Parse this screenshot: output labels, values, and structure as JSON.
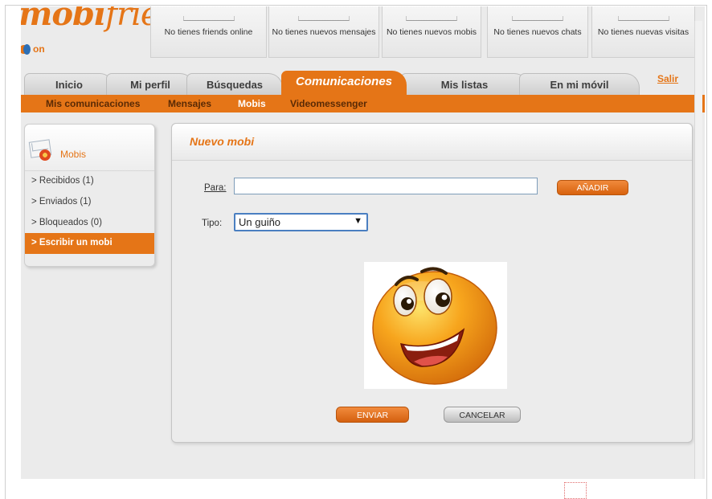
{
  "header": {
    "logo_bold": "mobi",
    "logo_thin": "friends",
    "status": "on",
    "notifications": [
      "No tienes friends online",
      "No tienes nuevos mensajes",
      "No tienes nuevos mobis",
      "No tienes nuevos chats",
      "No tienes nuevas visitas"
    ]
  },
  "tabs": [
    "Inicio",
    "Mi perfil",
    "Búsquedas",
    "Comunicaciones",
    "Mis listas",
    "En mi móvil"
  ],
  "active_tab": "Comunicaciones",
  "logout_label": "Salir",
  "subnav": [
    "Mis comunicaciones",
    "Mensajes",
    "Mobis",
    "Videomessenger"
  ],
  "active_subnav": "Mobis",
  "sidebar": {
    "title": "Mobis",
    "items": [
      "> Recibidos (1)",
      "> Enviados (1)",
      "> Bloqueados (0)",
      "> Escribir un mobi"
    ],
    "active_item": "> Escribir un mobi"
  },
  "form": {
    "title": "Nuevo mobi",
    "to_label": "Para:",
    "to_value": "",
    "add_label": "AÑADIR",
    "type_label": "Tipo:",
    "type_value": "Un guiño",
    "preview_icon": "winking-smiley-icon",
    "send_label": "ENVIAR",
    "cancel_label": "CANCELAR"
  },
  "colors": {
    "accent": "#e57517",
    "tab_inactive": "#d6d6d6",
    "subnav_text": "#5a2a05",
    "panel_bg": "#ececec"
  }
}
